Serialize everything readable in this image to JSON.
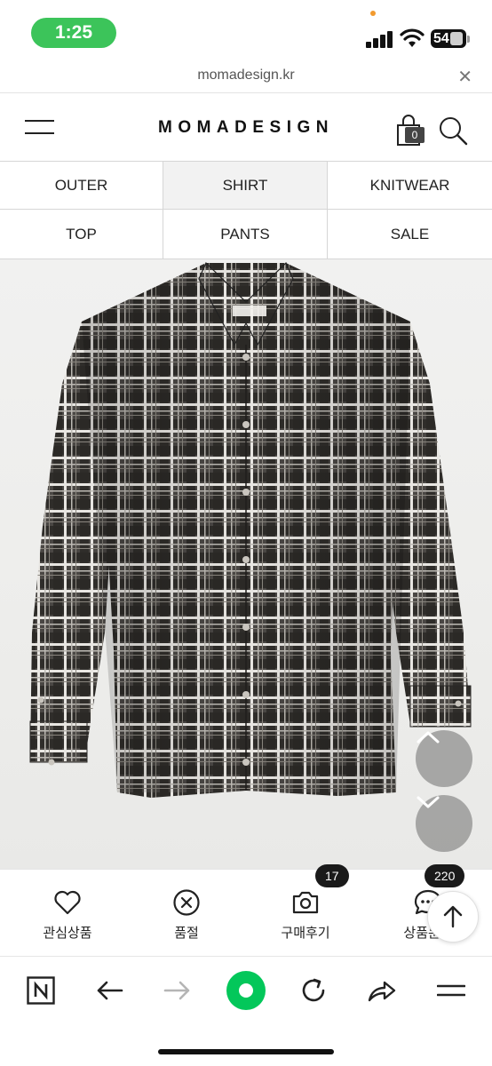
{
  "status_bar": {
    "time": "1:25",
    "battery": "54"
  },
  "browser": {
    "url": "momadesign.kr"
  },
  "header": {
    "logo": "MOMADESIGN",
    "cart_count": "0"
  },
  "categories": [
    {
      "label": "OUTER",
      "active": false
    },
    {
      "label": "SHIRT",
      "active": true
    },
    {
      "label": "KNITWEAR",
      "active": false
    },
    {
      "label": "TOP",
      "active": false
    },
    {
      "label": "PANTS",
      "active": false
    },
    {
      "label": "SALE",
      "active": false
    }
  ],
  "product": {
    "image": "plaid-long-sleeve-shirt",
    "colors": {
      "dark": "#2f2d2b",
      "light": "#e8e6e2"
    }
  },
  "actions": [
    {
      "label": "관심상품",
      "icon": "heart-icon"
    },
    {
      "label": "품절",
      "icon": "circle-x-icon"
    },
    {
      "label": "구매후기",
      "icon": "camera-icon",
      "badge": "17"
    },
    {
      "label": "상품문의",
      "icon": "chat-bubble-icon",
      "badge": "220"
    }
  ],
  "accent": {
    "time_pill": "#3cc45a",
    "naver_green": "#03c75a"
  }
}
